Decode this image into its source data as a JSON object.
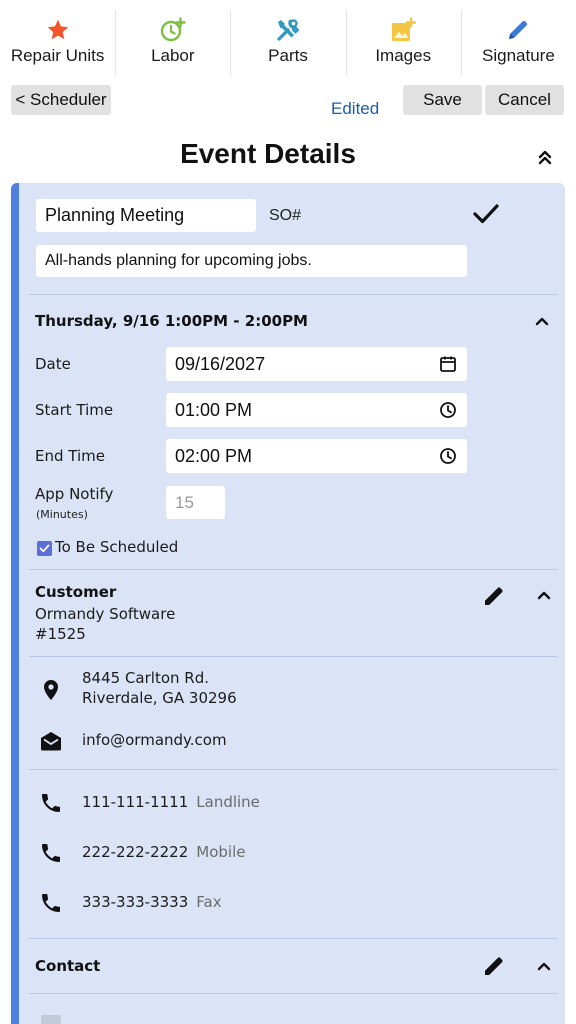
{
  "toolbar": {
    "items": [
      {
        "label": "Repair Units",
        "icon": "star-icon"
      },
      {
        "label": "Labor",
        "icon": "clock-plus-icon"
      },
      {
        "label": "Parts",
        "icon": "tools-icon"
      },
      {
        "label": "Images",
        "icon": "image-plus-icon"
      },
      {
        "label": "Signature",
        "icon": "pencil-icon"
      }
    ]
  },
  "actions": {
    "back_label": "< Scheduler",
    "status": "Edited",
    "save_label": "Save",
    "cancel_label": "Cancel"
  },
  "page": {
    "title": "Event Details"
  },
  "event": {
    "title": "Planning Meeting",
    "so_label": "SO#",
    "description": "All-hands planning for upcoming jobs.",
    "when_heading": "Thursday, 9/16 1:00PM - 2:00PM",
    "date_label": "Date",
    "date_value": "09/16/2027",
    "start_label": "Start Time",
    "start_value": "01:00 PM",
    "end_label": "End Time",
    "end_value": "02:00 PM",
    "notify_label": "App Notify",
    "notify_sub": "(Minutes)",
    "notify_placeholder": "15",
    "to_be_scheduled_label": "To Be Scheduled",
    "to_be_scheduled_checked": true
  },
  "customer": {
    "heading": "Customer",
    "name": "Ormandy Software",
    "number": "#1525",
    "address_line1": "8445 Carlton Rd.",
    "address_line2": "Riverdale, GA 30296",
    "email": "info@ormandy.com",
    "phones": [
      {
        "number": "111-111-1111",
        "type": "Landline"
      },
      {
        "number": "222-222-2222",
        "type": "Mobile"
      },
      {
        "number": "333-333-3333",
        "type": "Fax"
      }
    ]
  },
  "contact": {
    "heading": "Contact"
  },
  "colors": {
    "accent": "#4f7fe0",
    "card_bg": "#dbe4f7",
    "status_text": "#1c5da9",
    "star": "#f0552b",
    "labor": "#7bc043",
    "parts": "#2a9bc1",
    "images": "#f2c744",
    "signature": "#3a7bd5"
  }
}
